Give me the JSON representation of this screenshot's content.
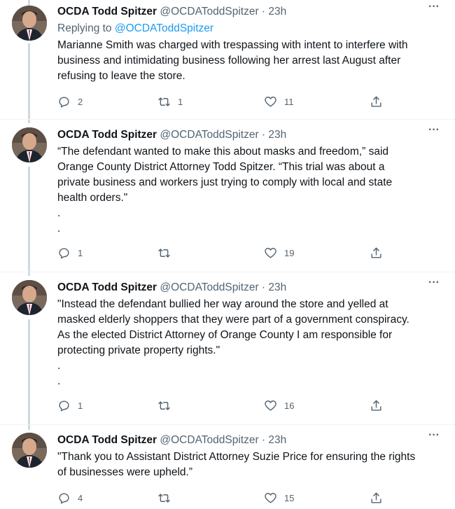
{
  "author": {
    "name": "OCDA Todd Spitzer",
    "handle": "@OCDAToddSpitzer",
    "separator": "·",
    "time": "23h"
  },
  "tweets": [
    {
      "reply_prefix": "Replying to ",
      "reply_handle": "@OCDAToddSpitzer",
      "lines": [
        "Marianne Smith was charged with trespassing with intent to interfere with",
        "business and intimidating business following her arrest last August after",
        "refusing to leave the store."
      ],
      "dots": [],
      "replies": "2",
      "retweets": "1",
      "likes": "11"
    },
    {
      "lines": [
        "“The defendant wanted to make this about masks and freedom,” said",
        "Orange County District Attorney Todd Spitzer. “This trial was about a",
        "private business and workers just trying to comply with local and state",
        "health orders.\""
      ],
      "dots": [
        ".",
        "."
      ],
      "replies": "1",
      "retweets": "",
      "likes": "19"
    },
    {
      "lines": [
        "\"Instead the defendant bullied her way around the store and yelled at",
        "masked elderly shoppers that they were part of a government conspiracy.",
        "As the elected District Attorney of Orange County I am responsible for",
        "protecting private property rights.\""
      ],
      "dots": [
        ".",
        "."
      ],
      "replies": "1",
      "retweets": "",
      "likes": "16"
    },
    {
      "lines": [
        "\"Thank you to Assistant District Attorney Suzie Price for ensuring the rights",
        "of businesses were upheld.”"
      ],
      "dots": [],
      "replies": "4",
      "retweets": "",
      "likes": "15"
    }
  ],
  "icons": {
    "reply": "reply-icon",
    "retweet": "retweet-icon",
    "like": "heart-icon",
    "share": "share-icon",
    "more": "more-icon"
  },
  "colors": {
    "link": "#1d9bf0",
    "secondary": "#536471",
    "text": "#0f1419",
    "thread_line": "#cfd9de"
  }
}
